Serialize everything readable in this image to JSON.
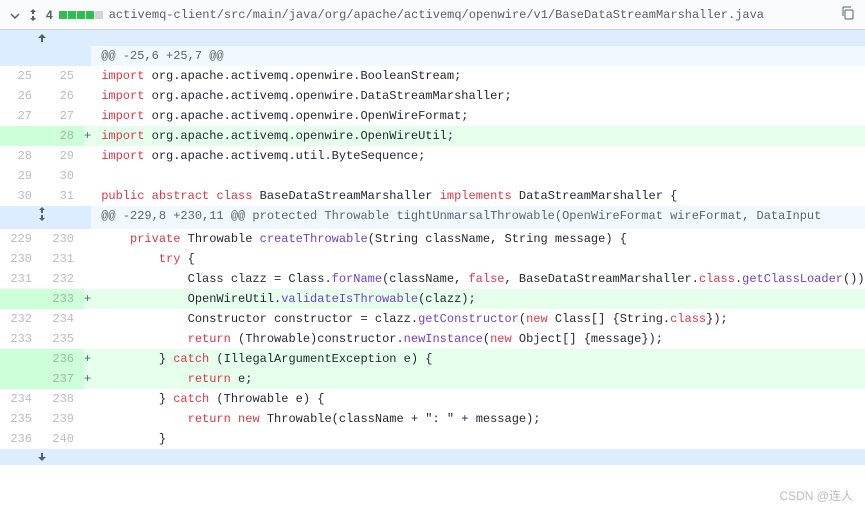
{
  "header": {
    "change_count": "4",
    "file_path": "activemq-client/src/main/java/org/apache/activemq/openwire/v1/BaseDataStreamMarshaller.java"
  },
  "hunks": {
    "h1": "@@ -25,6 +25,7 @@",
    "h2": "@@ -229,8 +230,11 @@ protected Throwable tightUnmarsalThrowable(OpenWireFormat wireFormat, DataInput"
  },
  "lines": {
    "l25o": "25",
    "l25n": "25",
    "l26o": "26",
    "l26n": "26",
    "l27o": "27",
    "l27n": "27",
    "l28n": "28",
    "l28o": "28",
    "l29n": "29",
    "l29o": "29",
    "l30n": "30",
    "l30o": "30",
    "l31n": "31",
    "l229o": "229",
    "l230n": "230",
    "l230o": "230",
    "l231n": "231",
    "l231o": "231",
    "l232n": "232",
    "l233n": "233",
    "l232o": "232",
    "l234n": "234",
    "l233o": "233",
    "l235n": "235",
    "l236n": "236",
    "l237n": "237",
    "l234o": "234",
    "l238n": "238",
    "l235o": "235",
    "l239n": "239",
    "l236o": "236",
    "l240n": "240"
  },
  "code": {
    "import_kw": "import",
    "public_kw": "public",
    "abstract_kw": "abstract",
    "class_kw": "class",
    "implements_kw": "implements",
    "private_kw": "private",
    "try_kw": "try",
    "catch_kw": "catch",
    "return_kw": "return",
    "new_kw": "new",
    "false_kw": "false",
    "c25": " org.apache.activemq.openwire.BooleanStream;",
    "c26": " org.apache.activemq.openwire.DataStreamMarshaller;",
    "c27": " org.apache.activemq.openwire.OpenWireFormat;",
    "c28": " org.apache.activemq.openwire.OpenWireUtil;",
    "c29": " org.apache.activemq.util.ByteSequence;",
    "c31a": " BaseDataStreamMarshaller ",
    "c31b": " DataStreamMarshaller {",
    "c230a": " Throwable ",
    "c230fn": "createThrowable",
    "c230b": "(String className, String message) {",
    "c231": " {",
    "c232a": "            Class clazz = Class.",
    "c232fn": "forName",
    "c232b": "(className, ",
    "c232c": ", BaseDataStreamMarshaller.",
    "c232d": ".",
    "c232fn2": "getClassLoader",
    "c232e": "());",
    "class_lit": "class",
    "c233a": "            OpenWireUtil.",
    "c233fn": "validateIsThrowable",
    "c233b": "(clazz);",
    "c234a": "            Constructor constructor = clazz.",
    "c234fn": "getConstructor",
    "c234b": "(",
    "c234c": " Class[] {String.",
    "c234d": "});",
    "c235a": "            ",
    "c235b": " (Throwable)constructor.",
    "c235fn": "newInstance",
    "c235c": "(",
    "c235d": " Object[] {message});",
    "c236a": "        } ",
    "c236b": " (IllegalArgumentException e) {",
    "c237a": "            ",
    "c237b": " e;",
    "c238a": "        } ",
    "c238b": " (Throwable e) {",
    "c239a": "            ",
    "c239b": " ",
    "c239c": " Throwable(className + \": \" + message);",
    "c240": "        }"
  },
  "watermark": "CSDN @连人"
}
